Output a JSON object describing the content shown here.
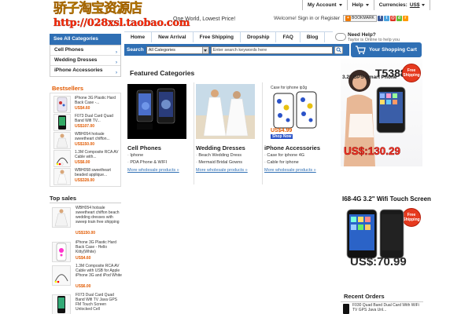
{
  "header": {
    "logo_cn": "骄子淘宝资源店",
    "logo_url": "http://028xsl.taobao.com",
    "slogan": "One World, Lowest Price!",
    "menu": {
      "account": "My Account",
      "help": "Help",
      "currencies_label": "Currencies:",
      "currency_value": "US$"
    },
    "welcome": "Welcome!",
    "signin": "Sign in",
    "or": "or",
    "register": "Register",
    "bookmark": "BOOKMARK"
  },
  "nav": {
    "items": [
      "Home",
      "New Arrival",
      "Free Shipping",
      "Dropship",
      "FAQ",
      "Blog"
    ],
    "need_help": "Need Help?",
    "online": "Taylor is Online to help you"
  },
  "sidebar": {
    "see_all": "See All Categories",
    "categories": [
      "Cell Phones",
      "Wedding Dresses",
      "iPhone Accessories"
    ],
    "bestsellers_title": "Bestsellers",
    "bestsellers": [
      {
        "name": "iPhone 3G Plastic Hard Back Case -...",
        "price": "US$4.60"
      },
      {
        "name": "F073 Dual Card Quad Band Wifi TV...",
        "price": "US$107.00"
      },
      {
        "name": "WBH054 hotsale sweetheart chiffon...",
        "price": "US$150.00"
      },
      {
        "name": "1.3M Composite RCA AV Cable with...",
        "price": "US$6.00"
      },
      {
        "name": "WBH058 sweetheart beaded applique...",
        "price": "US$328.00"
      }
    ],
    "topsales_title": "Top sales",
    "topsales": [
      {
        "name": "WBH054 hotsale sweetheart chiffon beach wedding dresses with sweep train free shipping",
        "price": "US$150.00"
      },
      {
        "name": "iPhone 3G Plastic Hard Back Case - Hello Kitty(White)",
        "price": "US$4.60"
      },
      {
        "name": "1.3M Composite RCA AV Cable with USB for Apple iPhone 3G and iPod White",
        "price": "US$6.00"
      },
      {
        "name": "F073 Dual Card Quad Band Wifi TV Java GPS FM Touch Screen Unlocked Cell",
        "price": ""
      }
    ]
  },
  "search": {
    "label": "Search",
    "category": "All Categories",
    "placeholder": "Enter search keywords here",
    "cart": "Your Shopping Cart"
  },
  "featured": {
    "title": "Featured Categories",
    "more": "More wholesale products »",
    "categories": [
      {
        "name": "Cell Phones",
        "items": [
          "Iphone",
          "PDA Phone & WIFI"
        ]
      },
      {
        "name": "Wedding Dresses",
        "items": [
          "Beach Wedding Dress",
          "Mermaid Bridal Gowns"
        ]
      },
      {
        "name": "iPhone Accessories",
        "items": [
          "Case for iphone 4G",
          "Cable for iphone"
        ],
        "img_caption": "Case for iphone ip3g",
        "img_price": "US$4.99",
        "img_shop": "Shop Now"
      }
    ]
  },
  "banners": {
    "b1_model": "T5388i",
    "b1_sub": "3.2\" GPS Smart Phone",
    "b1_price": "US$:130.29",
    "b2_title": "I68-4G 3.2\" Wifi Touch Screen",
    "b2_price": "US$:70.99",
    "badge_line1": "Free",
    "badge_line2": "Shipping",
    "colors": {
      "accent": "#2f6fb4",
      "price_orange": "#e25a00",
      "banner_red": "#ff3b2a"
    }
  },
  "recent_orders": {
    "title": "Recent Orders",
    "item": "F030 Quad Band Dual Card With WiFi TV GPS Java Unl..."
  }
}
